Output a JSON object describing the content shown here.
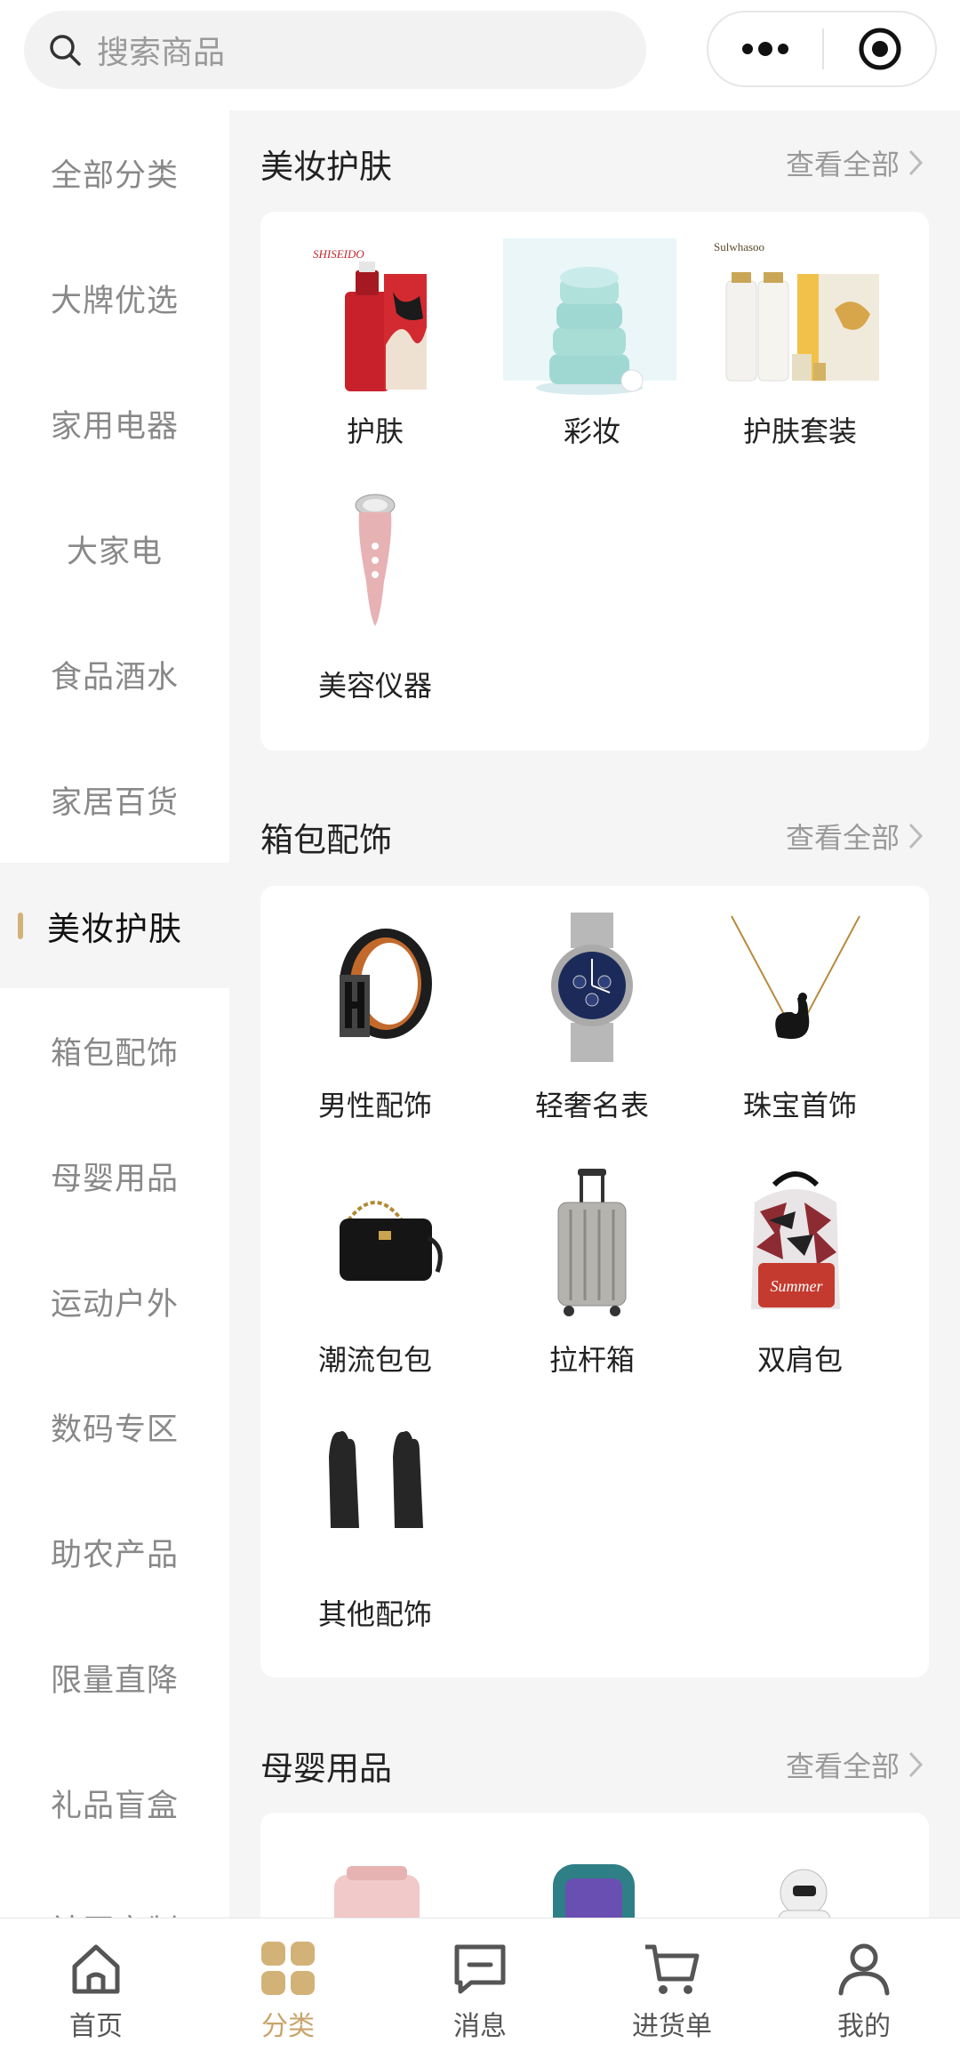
{
  "search": {
    "placeholder": "搜索商品",
    "icon": "search-icon"
  },
  "capsule": {
    "more_icon": "more-dots-icon",
    "close_icon": "target-icon"
  },
  "sidebar": {
    "active_index": 6,
    "items": [
      {
        "label": "全部分类"
      },
      {
        "label": "大牌优选"
      },
      {
        "label": "家用电器"
      },
      {
        "label": "大家电"
      },
      {
        "label": "食品酒水"
      },
      {
        "label": "家居百货"
      },
      {
        "label": "美妆护肤"
      },
      {
        "label": "箱包配饰"
      },
      {
        "label": "母婴用品"
      },
      {
        "label": "运动户外"
      },
      {
        "label": "数码专区"
      },
      {
        "label": "助农产品"
      },
      {
        "label": "限量直降"
      },
      {
        "label": "礼品盲盒"
      },
      {
        "label": "社区定制"
      }
    ]
  },
  "sections": [
    {
      "title": "美妆护肤",
      "view_all": "查看全部",
      "items": [
        {
          "label": "护肤"
        },
        {
          "label": "彩妆"
        },
        {
          "label": "护肤套装"
        },
        {
          "label": "美容仪器"
        }
      ]
    },
    {
      "title": "箱包配饰",
      "view_all": "查看全部",
      "items": [
        {
          "label": "男性配饰"
        },
        {
          "label": "轻奢名表"
        },
        {
          "label": "珠宝首饰"
        },
        {
          "label": "潮流包包"
        },
        {
          "label": "拉杆箱"
        },
        {
          "label": "双肩包"
        },
        {
          "label": "其他配饰"
        }
      ]
    },
    {
      "title": "母婴用品",
      "view_all": "查看全部",
      "items": []
    }
  ],
  "product_images": {
    "shiseido_logo": "SHISEIDO",
    "sulwhasoo_logo": "Sulwhasoo",
    "summer_text": "Summer"
  },
  "tabbar": {
    "active_index": 1,
    "items": [
      {
        "label": "首页",
        "icon": "home-icon"
      },
      {
        "label": "分类",
        "icon": "category-grid-icon"
      },
      {
        "label": "消息",
        "icon": "message-icon"
      },
      {
        "label": "进货单",
        "icon": "cart-icon"
      },
      {
        "label": "我的",
        "icon": "user-icon"
      }
    ]
  },
  "colors": {
    "accent": "#c9a46a",
    "active_bar": "#d3b278"
  }
}
